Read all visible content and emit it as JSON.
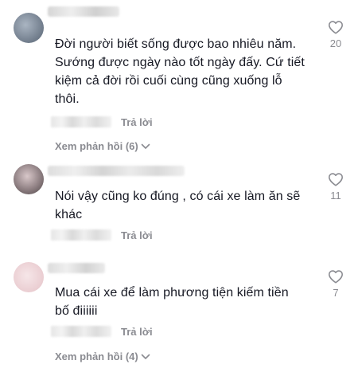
{
  "comments": [
    {
      "text_lines": [
        "Đời người biết sống được bao nhiêu năm.",
        "Sướng được ngày nào tốt ngày đấy. Cứ tiết",
        "kiệm cả đời rồi cuối cùng cũng xuống lỗ",
        "thôi."
      ],
      "reply_label": "Trả lời",
      "view_replies_label": "Xem phản hồi (6)",
      "likes": "20"
    },
    {
      "text_lines": [
        "Nói vậy cũng ko đúng , có cái xe làm ăn sẽ",
        "khác"
      ],
      "reply_label": "Trả lời",
      "likes": "11"
    },
    {
      "text_lines": [
        "Mua cái xe để làm phương tiện kiếm tiền",
        "bố điiiiii"
      ],
      "reply_label": "Trả lời",
      "view_replies_label": "Xem phản hồi (4)",
      "likes": "7"
    }
  ],
  "icons": {
    "like": "heart-outline-icon",
    "expand": "chevron-down-icon"
  },
  "colors": {
    "text": "#161823",
    "secondary": "#8a8b91",
    "icon": "#8a8b91"
  }
}
